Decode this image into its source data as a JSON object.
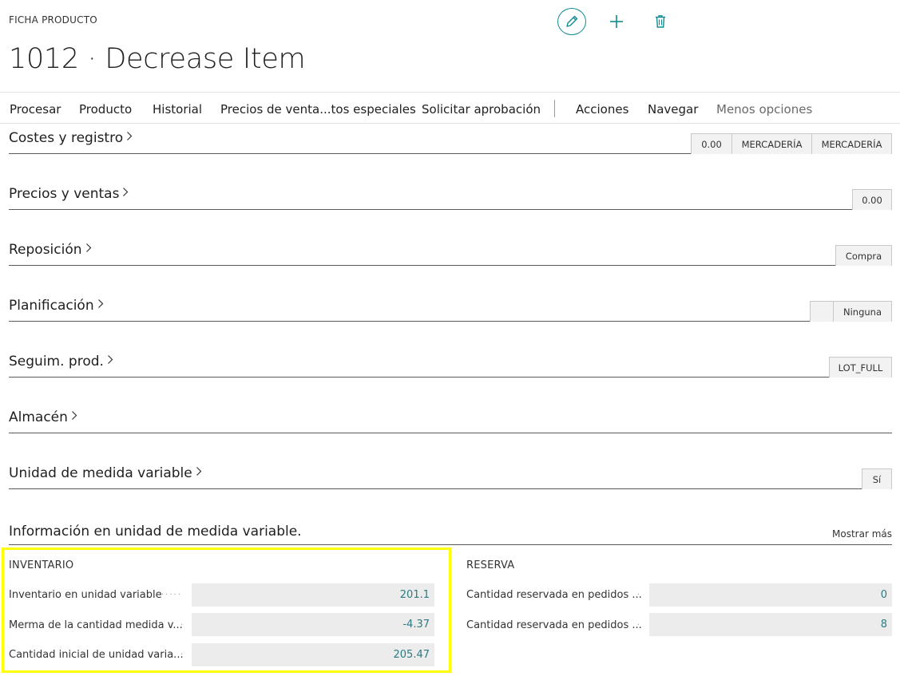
{
  "header": {
    "caption": "FICHA PRODUCTO",
    "title": "1012 · Decrease Item"
  },
  "actions": {
    "procesar": "Procesar",
    "producto": "Producto",
    "historial": "Historial",
    "precios": "Precios de venta...tos especiales",
    "solicitar": "Solicitar aprobación",
    "acciones": "Acciones",
    "navegar": "Navegar",
    "menos": "Menos opciones"
  },
  "fasttabs": {
    "costes": {
      "label": "Costes y registro",
      "values": [
        "0.00",
        "MERCADERÍA",
        "MERCADERÍA"
      ]
    },
    "precios": {
      "label": "Precios y ventas",
      "values": [
        "0.00"
      ]
    },
    "reposicion": {
      "label": "Reposición",
      "values": [
        "Compra"
      ]
    },
    "planificacion": {
      "label": "Planificación",
      "values": [
        "",
        "Ninguna"
      ]
    },
    "seguim": {
      "label": "Seguim. prod.",
      "values": [
        "LOT_FULL"
      ]
    },
    "almacen": {
      "label": "Almacén"
    },
    "unidad": {
      "label": "Unidad de medida variable",
      "values": [
        "Sí"
      ]
    }
  },
  "info": {
    "title": "Información en unidad de medida variable.",
    "show_more": "Mostrar más",
    "inventario": {
      "title": "INVENTARIO",
      "fields": [
        {
          "label": "Inventario en unidad variable",
          "value": "201.1"
        },
        {
          "label": "Merma de la cantidad medida v...",
          "value": "-4.37"
        },
        {
          "label": "Cantidad inicial de unidad varia...",
          "value": "205.47"
        }
      ]
    },
    "reserva": {
      "title": "RESERVA",
      "fields": [
        {
          "label": "Cantidad reservada en pedidos ...",
          "value": "0"
        },
        {
          "label": "Cantidad reservada en pedidos ...",
          "value": "8"
        }
      ]
    }
  },
  "colors": {
    "accent": "#0e8a91",
    "highlight": "#ffff00",
    "value_text": "#2e7a80"
  }
}
